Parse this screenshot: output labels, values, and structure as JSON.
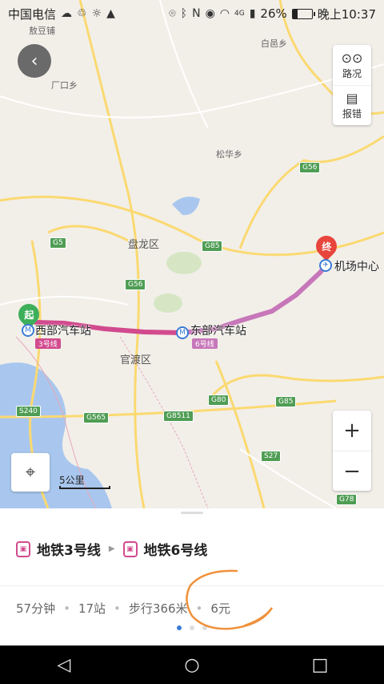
{
  "status_bar": {
    "carrier": "中国电信",
    "signal": "4G",
    "battery": "26%",
    "battery_fraction": 0.26,
    "time": "晚上10:37"
  },
  "map": {
    "places": [
      {
        "name": "敖豆铺"
      },
      {
        "name": "白邑乡"
      },
      {
        "name": "厂口乡"
      },
      {
        "name": "松华乡"
      },
      {
        "name": "盘龙区"
      },
      {
        "name": "官渡区"
      }
    ],
    "highways": [
      "G56",
      "G5",
      "G85",
      "G56",
      "G80",
      "G85",
      "G8511",
      "G565",
      "S240",
      "S27",
      "G78"
    ],
    "start_station": {
      "name": "西部汽车站",
      "line": "3号线",
      "pin_label": "起"
    },
    "transfer_station": {
      "name": "东部汽车站",
      "line": "6号线"
    },
    "end_station": {
      "name": "机场中心",
      "pin_label": "终"
    },
    "scale_label": "5公里",
    "route_colors": {
      "line3": "#d24a8e",
      "line6": "#c777b9",
      "start_pin": "#3daf5a",
      "end_pin": "#e8453c"
    }
  },
  "controls": {
    "back_icon": "chevron-left-icon",
    "traffic_label": "路况",
    "report_label": "报错",
    "zoom_in": "+",
    "zoom_out": "−"
  },
  "route": {
    "lines": [
      "地铁3号线",
      "地铁6号线"
    ],
    "duration": "57分钟",
    "stops": "17站",
    "walk": "步行366米",
    "fare": "6元",
    "page_count": 3,
    "page_index": 0
  },
  "navbar": {
    "back": "◁",
    "home": "○",
    "recent": "□"
  }
}
